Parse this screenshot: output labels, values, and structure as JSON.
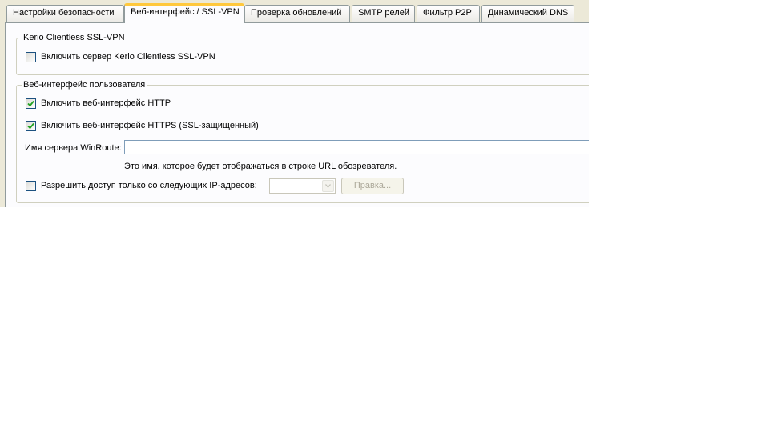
{
  "tabs": [
    {
      "label": "Настройки безопасности",
      "active": false
    },
    {
      "label": "Веб-интерфейс / SSL-VPN",
      "active": true
    },
    {
      "label": "Проверка обновлений",
      "active": false
    },
    {
      "label": "SMTP релей",
      "active": false
    },
    {
      "label": "Фильтр P2P",
      "active": false
    },
    {
      "label": "Динамический DNS",
      "active": false
    }
  ],
  "ssl_vpn_group": {
    "title": "Kerio Clientless SSL-VPN",
    "enable_server": {
      "label": "Включить сервер Kerio Clientless SSL-VPN",
      "checked": false
    }
  },
  "web_ui_group": {
    "title": "Веб-интерфейс пользователя",
    "enable_http": {
      "label": "Включить веб-интерфейс HTTP",
      "checked": true
    },
    "enable_https": {
      "label": "Включить веб-интерфейс HTTPS (SSL-защищенный)",
      "checked": true
    },
    "server_name_label": "Имя сервера WinRoute:",
    "server_name_value": "",
    "server_name_hint": "Это имя, которое будет отображаться в строке URL обозревателя.",
    "restrict_ip": {
      "label": "Разрешить доступ только со следующих IP-адресов:",
      "checked": false
    },
    "ip_group_value": "",
    "edit_button_label": "Правка..."
  }
}
